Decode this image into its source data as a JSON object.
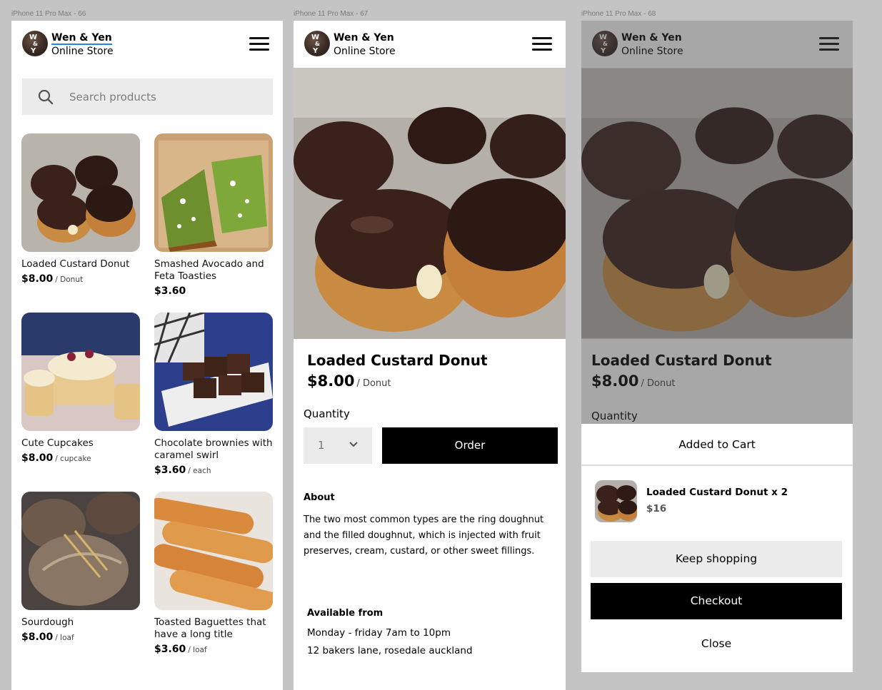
{
  "frames": {
    "list_label": "iPhone 11 Pro Max - 66",
    "detail_label": "iPhone 11 Pro Max - 67",
    "cart_label": "iPhone 11 Pro Max - 68"
  },
  "header": {
    "logo_letters": [
      "W",
      "&",
      "Y"
    ],
    "brand_line1": "Wen & Yen",
    "brand_line2": "Online Store",
    "menu_icon": "hamburger-menu-icon"
  },
  "search": {
    "placeholder": "Search products",
    "icon": "search-icon"
  },
  "products": [
    {
      "name": "Loaded Custard Donut",
      "price": "$8.00",
      "unit": "/ Donut"
    },
    {
      "name": "Smashed Avocado and Feta Toasties",
      "price": "$3.60",
      "unit": ""
    },
    {
      "name": "Cute Cupcakes",
      "price": "$8.00",
      "unit": "/ cupcake"
    },
    {
      "name": "Chocolate brownies with caramel swirl",
      "price": "$3.60",
      "unit": "/ each"
    },
    {
      "name": "Sourdough",
      "price": "$8.00",
      "unit": "/ loaf"
    },
    {
      "name": "Toasted Baguettes that have a long title",
      "price": "$3.60",
      "unit": "/ loaf"
    }
  ],
  "detail": {
    "title": "Loaded Custard Donut",
    "price": "$8.00",
    "unit": "/ Donut",
    "quantity_label": "Quantity",
    "quantity_value": "1",
    "order_label": "Order",
    "about_heading": "About",
    "about_text": "The two most common types are the ring doughnut and the filled doughnut, which is injected with fruit preserves, cream, custard, or other sweet fillings.",
    "available_heading": "Available from",
    "available_hours": "Monday - friday 7am to 10pm",
    "available_address": "12 bakers lane, rosedale auckland"
  },
  "cart_sheet": {
    "title": "Added to Cart",
    "item_name": "Loaded Custard Donut x 2",
    "item_price": "$16",
    "keep_shopping_label": "Keep shopping",
    "checkout_label": "Checkout",
    "close_label": "Close"
  },
  "colors": {
    "background": "#c4c4c4",
    "primary_button": "#000000",
    "secondary_button": "#ebebeb",
    "link_underline": "#1e88e5"
  }
}
